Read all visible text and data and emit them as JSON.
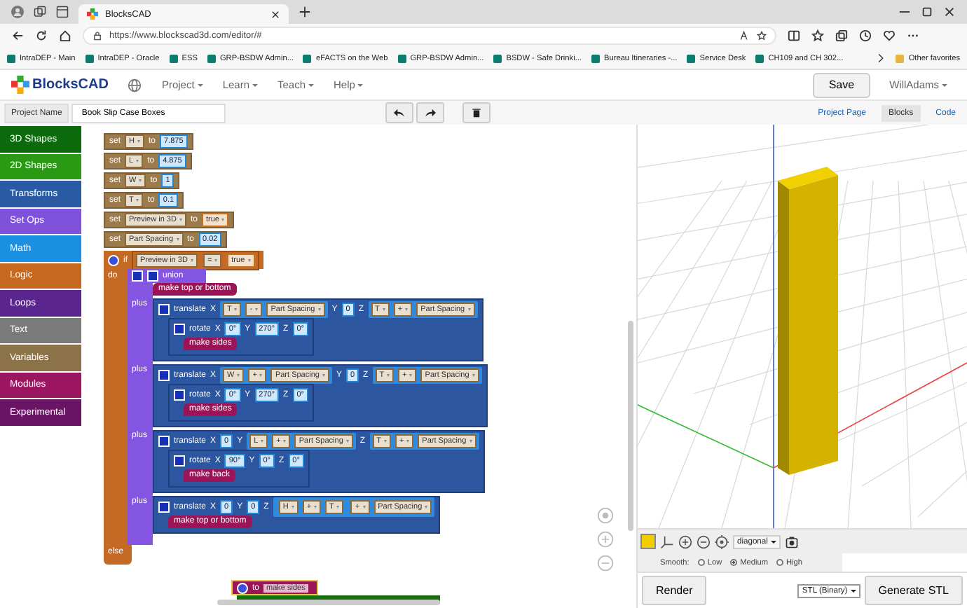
{
  "browser": {
    "tab_title": "BlocksCAD",
    "url": "https://www.blockscad3d.com/editor/#",
    "bookmarks": [
      "IntraDEP - Main",
      "IntraDEP - Oracle",
      "ESS",
      "GRP-BSDW Admin...",
      "eFACTS on the Web",
      "GRP-BSDW Admin...",
      "BSDW - Safe Drinki...",
      "Bureau Itineraries -...",
      "Service Desk",
      "CH109 and CH 302..."
    ],
    "other_favorites": "Other favorites"
  },
  "app": {
    "logo": "BlocksCAD",
    "menus": [
      "Project",
      "Learn",
      "Teach",
      "Help"
    ],
    "save": "Save",
    "user": "WillAdams",
    "project_label": "Project Name",
    "project_name": "Book Slip Case Boxes",
    "view_tabs": [
      {
        "label": "Project Page",
        "selected": false
      },
      {
        "label": "Blocks",
        "selected": true
      },
      {
        "label": "Code",
        "selected": false
      }
    ]
  },
  "categories": [
    {
      "label": "3D Shapes",
      "color": "#0b6a0b"
    },
    {
      "label": "2D Shapes",
      "color": "#2a9a14"
    },
    {
      "label": "Transforms",
      "color": "#2a5aa4"
    },
    {
      "label": "Set Ops",
      "color": "#8052dc"
    },
    {
      "label": "Math",
      "color": "#1b8fe0"
    },
    {
      "label": "Logic",
      "color": "#c6681e"
    },
    {
      "label": "Loops",
      "color": "#5b2590"
    },
    {
      "label": "Text",
      "color": "#7a7a7a"
    },
    {
      "label": "Variables",
      "color": "#8c7249"
    },
    {
      "label": "Modules",
      "color": "#9c1560"
    },
    {
      "label": "Experimental",
      "color": "#6a1466"
    }
  ],
  "workspace": {
    "sets": [
      {
        "label": "set",
        "variable": "H",
        "joiner": "to",
        "value": "7.875",
        "kind": "number"
      },
      {
        "label": "set",
        "variable": "L",
        "joiner": "to",
        "value": "4.875",
        "kind": "number"
      },
      {
        "label": "set",
        "variable": "W",
        "joiner": "to",
        "value": "1",
        "kind": "number"
      },
      {
        "label": "set",
        "variable": "T",
        "joiner": "to",
        "value": "0.1",
        "kind": "number"
      },
      {
        "label": "set",
        "variable": "Preview in 3D",
        "joiner": "to",
        "value": "true",
        "kind": "bool"
      },
      {
        "label": "set",
        "variable": "Part Spacing",
        "joiner": "to",
        "value": "0.02",
        "kind": "number"
      }
    ],
    "if_block": {
      "keyword": "if",
      "condition": [
        {
          "kind": "var",
          "text": "Preview in 3D"
        },
        {
          "kind": "op",
          "text": "="
        },
        {
          "kind": "bool",
          "text": "true"
        }
      ],
      "do_label": "do",
      "else_label": "else",
      "union": {
        "label": "union",
        "first": "make top or bottom",
        "items": [
          {
            "label": "plus",
            "statement": {
              "kind": "translate",
              "label": "translate",
              "axes": [
                {
                  "axis": "X",
                  "value": [
                    {
                      "kind": "group",
                      "tokens": [
                        {
                          "kind": "var",
                          "text": "T"
                        },
                        {
                          "kind": "op",
                          "text": "-"
                        },
                        {
                          "kind": "var",
                          "text": "Part Spacing"
                        }
                      ]
                    }
                  ]
                },
                {
                  "axis": "Y",
                  "value": [
                    {
                      "kind": "num",
                      "text": "0"
                    }
                  ]
                },
                {
                  "axis": "Z",
                  "value": [
                    {
                      "kind": "group",
                      "tokens": [
                        {
                          "kind": "var",
                          "text": "T"
                        },
                        {
                          "kind": "op",
                          "text": "+"
                        },
                        {
                          "kind": "var",
                          "text": "Part Spacing"
                        }
                      ]
                    }
                  ]
                }
              ],
              "children": [
                {
                  "kind": "rotate",
                  "label": "rotate",
                  "axes": [
                    {
                      "axis": "X",
                      "value": [
                        {
                          "kind": "num",
                          "text": "0°"
                        }
                      ]
                    },
                    {
                      "axis": "Y",
                      "value": [
                        {
                          "kind": "num",
                          "text": "270°"
                        }
                      ]
                    },
                    {
                      "axis": "Z",
                      "value": [
                        {
                          "kind": "num",
                          "text": "0°"
                        }
                      ]
                    }
                  ],
                  "children": [
                    {
                      "kind": "call",
                      "label": "make sides"
                    }
                  ]
                }
              ]
            }
          },
          {
            "label": "plus",
            "statement": {
              "kind": "translate",
              "label": "translate",
              "axes": [
                {
                  "axis": "X",
                  "value": [
                    {
                      "kind": "group",
                      "tokens": [
                        {
                          "kind": "var",
                          "text": "W"
                        },
                        {
                          "kind": "op",
                          "text": "+"
                        },
                        {
                          "kind": "var",
                          "text": "Part Spacing"
                        }
                      ]
                    }
                  ]
                },
                {
                  "axis": "Y",
                  "value": [
                    {
                      "kind": "num",
                      "text": "0"
                    }
                  ]
                },
                {
                  "axis": "Z",
                  "value": [
                    {
                      "kind": "group",
                      "tokens": [
                        {
                          "kind": "var",
                          "text": "T"
                        },
                        {
                          "kind": "op",
                          "text": "+"
                        },
                        {
                          "kind": "var",
                          "text": "Part Spacing"
                        }
                      ]
                    }
                  ]
                }
              ],
              "children": [
                {
                  "kind": "rotate",
                  "label": "rotate",
                  "axes": [
                    {
                      "axis": "X",
                      "value": [
                        {
                          "kind": "num",
                          "text": "0°"
                        }
                      ]
                    },
                    {
                      "axis": "Y",
                      "value": [
                        {
                          "kind": "num",
                          "text": "270°"
                        }
                      ]
                    },
                    {
                      "axis": "Z",
                      "value": [
                        {
                          "kind": "num",
                          "text": "0°"
                        }
                      ]
                    }
                  ],
                  "children": [
                    {
                      "kind": "call",
                      "label": "make sides"
                    }
                  ]
                }
              ]
            }
          },
          {
            "label": "plus",
            "statement": {
              "kind": "translate",
              "label": "translate",
              "axes": [
                {
                  "axis": "X",
                  "value": [
                    {
                      "kind": "num",
                      "text": "0"
                    }
                  ]
                },
                {
                  "axis": "Y",
                  "value": [
                    {
                      "kind": "group",
                      "tokens": [
                        {
                          "kind": "var",
                          "text": "L"
                        },
                        {
                          "kind": "op",
                          "text": "+"
                        },
                        {
                          "kind": "var",
                          "text": "Part Spacing"
                        }
                      ]
                    }
                  ]
                },
                {
                  "axis": "Z",
                  "value": [
                    {
                      "kind": "group",
                      "tokens": [
                        {
                          "kind": "var",
                          "text": "T"
                        },
                        {
                          "kind": "op",
                          "text": "+"
                        },
                        {
                          "kind": "var",
                          "text": "Part Spacing"
                        }
                      ]
                    }
                  ]
                }
              ],
              "children": [
                {
                  "kind": "rotate",
                  "label": "rotate",
                  "axes": [
                    {
                      "axis": "X",
                      "value": [
                        {
                          "kind": "num",
                          "text": "90°"
                        }
                      ]
                    },
                    {
                      "axis": "Y",
                      "value": [
                        {
                          "kind": "num",
                          "text": "0°"
                        }
                      ]
                    },
                    {
                      "axis": "Z",
                      "value": [
                        {
                          "kind": "num",
                          "text": "0°"
                        }
                      ]
                    }
                  ],
                  "children": [
                    {
                      "kind": "call",
                      "label": "make back"
                    }
                  ]
                }
              ]
            }
          },
          {
            "label": "plus",
            "statement": {
              "kind": "translate",
              "label": "translate",
              "axes": [
                {
                  "axis": "X",
                  "value": [
                    {
                      "kind": "num",
                      "text": "0"
                    }
                  ]
                },
                {
                  "axis": "Y",
                  "value": [
                    {
                      "kind": "num",
                      "text": "0"
                    }
                  ]
                },
                {
                  "axis": "Z",
                  "value": [
                    {
                      "kind": "group",
                      "tokens": [
                        {
                          "kind": "group",
                          "tokens": [
                            {
                              "kind": "var",
                              "text": "H"
                            },
                            {
                              "kind": "op",
                              "text": "+"
                            },
                            {
                              "kind": "var",
                              "text": "T"
                            }
                          ]
                        },
                        {
                          "kind": "op",
                          "text": "+"
                        },
                        {
                          "kind": "var",
                          "text": "Part Spacing"
                        }
                      ]
                    }
                  ]
                }
              ],
              "children": [
                {
                  "kind": "call",
                  "label": "make top or bottom"
                }
              ]
            }
          }
        ]
      }
    },
    "procedure": {
      "keyword": "to",
      "name": "make sides"
    }
  },
  "viewer": {
    "view": "diagonal",
    "smooth_label": "Smooth:",
    "smooth": [
      {
        "label": "Low",
        "selected": false
      },
      {
        "label": "Medium",
        "selected": true
      },
      {
        "label": "High",
        "selected": false
      }
    ],
    "render": "Render",
    "format": "STL (Binary)",
    "generate": "Generate STL"
  }
}
